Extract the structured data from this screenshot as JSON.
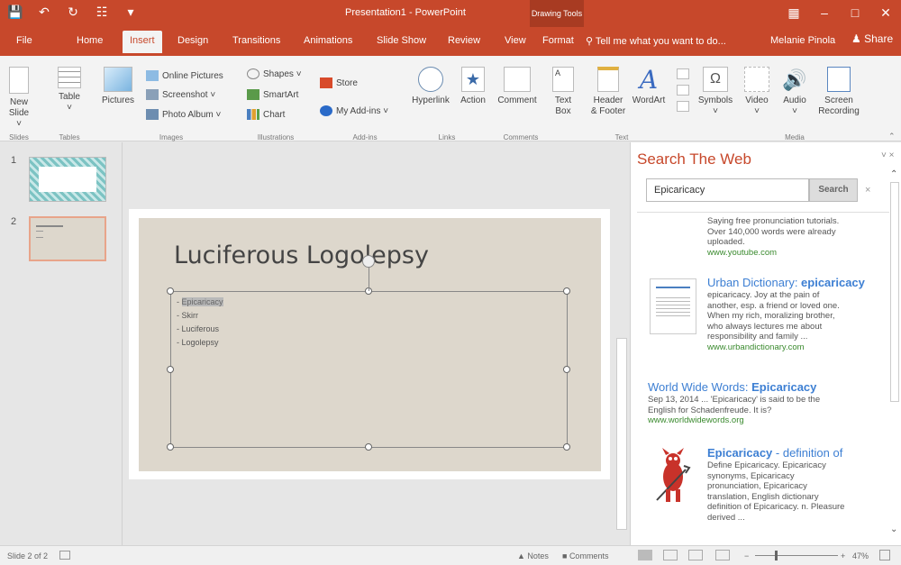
{
  "window": {
    "title": "Presentation1 - PowerPoint",
    "context_header": "Drawing Tools"
  },
  "tabs": [
    "File",
    "Home",
    "Insert",
    "Design",
    "Transitions",
    "Animations",
    "Slide Show",
    "Review",
    "View",
    "Format"
  ],
  "active_tab": "Insert",
  "tell_me": "Tell me what you want to do...",
  "user": "Melanie Pinola",
  "share": "Share",
  "ribbon": {
    "new_slide": [
      "New",
      "Slide ˅"
    ],
    "table": [
      "Table",
      "˅"
    ],
    "pictures": "Pictures",
    "online_pictures": "Online Pictures",
    "screenshot": "Screenshot ˅",
    "photo_album": "Photo Album ˅",
    "shapes": "Shapes ˅",
    "smartart": "SmartArt",
    "chart": "Chart",
    "store": "Store",
    "my_addins": "My Add-ins ˅",
    "hyperlink": "Hyperlink",
    "action": "Action",
    "comment": "Comment",
    "text_box": [
      "Text",
      "Box"
    ],
    "header_footer": [
      "Header",
      "& Footer"
    ],
    "wordart": "WordArt",
    "symbols": "Symbols",
    "video": "Video",
    "audio": "Audio",
    "screen_recording": [
      "Screen",
      "Recording"
    ],
    "groups": [
      "Slides",
      "Tables",
      "Images",
      "Illustrations",
      "Add-ins",
      "Links",
      "Comments",
      "Text",
      "Media"
    ]
  },
  "thumbnails": [
    "1",
    "2"
  ],
  "slide": {
    "title": "Luciferous Logolepsy",
    "bullets": [
      "Epicaricacy",
      "Skirr",
      "Luciferous",
      "Logolepsy"
    ]
  },
  "pane": {
    "title": "Search The Web",
    "query": "Epicaricacy",
    "search_button": "Search",
    "close": "×",
    "results": [
      {
        "lines": [
          "Saying free pronunciation tutorials.",
          "Over 140,000 words were already",
          "uploaded."
        ],
        "url": "www.youtube.com"
      },
      {
        "title_a": "Urban Dictionary: ",
        "title_b": "epicaricacy",
        "lines": [
          "epicaricacy. Joy at the pain of",
          "another, esp. a friend or loved one.",
          "When my rich, moralizing brother,",
          "who always lectures me about",
          "responsibility and family ..."
        ],
        "url": "www.urbandictionary.com"
      },
      {
        "title_a": "World Wide Words: ",
        "title_b": "Epicaricacy",
        "lines": [
          "Sep 13, 2014 ... 'Epicaricacy' is said to be the",
          "English for Schadenfreude. It is?"
        ],
        "url": "www.worldwidewords.org"
      },
      {
        "title_a": "Epicaricacy",
        "title_b": " - definition of",
        "lines": [
          "Define Epicaricacy. Epicaricacy",
          "synonyms, Epicaricacy",
          "pronunciation, Epicaricacy",
          "translation, English dictionary",
          "definition of Epicaricacy. n. Pleasure",
          "derived ..."
        ]
      }
    ]
  },
  "status": {
    "slide_of": "Slide 2 of 2",
    "notes": "Notes",
    "comments": "Comments",
    "zoom": "47%"
  },
  "colors": {
    "accent": "#c7482b",
    "slide_bg": "#ddd7cc",
    "link": "#3d7fd3",
    "url": "#3a8a2e"
  }
}
